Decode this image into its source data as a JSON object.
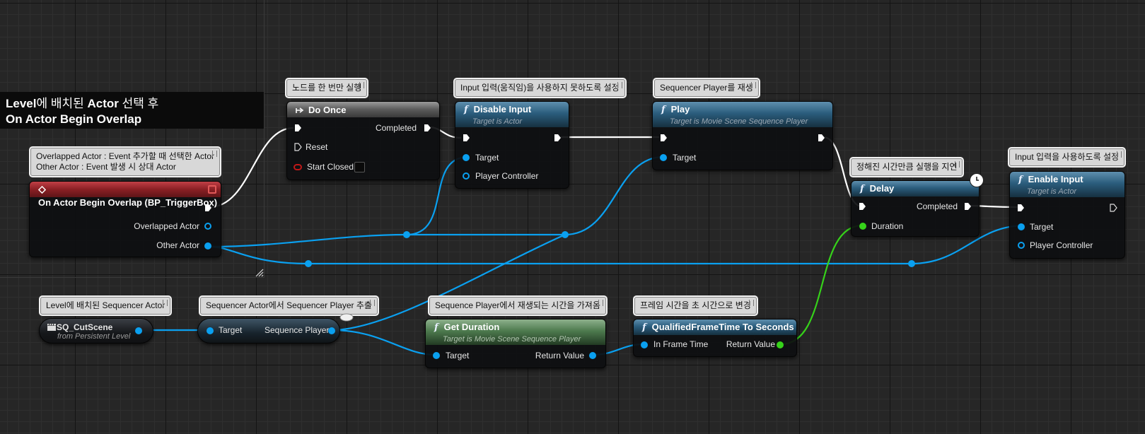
{
  "comment_region": {
    "line1_a": "Level",
    "line1_b": "에 배치된 ",
    "line1_c": "Actor",
    "line1_d": " 선택 후",
    "line2": "On Actor Begin Overlap"
  },
  "bubbles": {
    "overlap": [
      "Overlapped Actor : Event 추가할 때 선택한 Actor",
      "Other Actor : Event 발생 시 상대 Actor"
    ],
    "do_once": "노드를 한 번만 실행",
    "disable_input": "Input 입력(움직임)을 사용하지 못하도록 설정",
    "play": "Sequencer Player를 재생",
    "delay": "정해진 시간만큼 실행을 지연",
    "enable_input": "Input 입력을 사용하도록 설정",
    "sq_actor": "Level에 배치된 Sequencer Actor",
    "get_player": "Sequencer Actor에서 Sequencer Player 추출",
    "get_duration": "Sequence Player에서 재생되는 시간을 가져옴",
    "to_seconds": "프레임 시간을 초 시간으로 변경"
  },
  "nodes": {
    "event": {
      "title": "On Actor Begin Overlap (BP_TriggerBox)",
      "pins": [
        "Overlapped Actor",
        "Other Actor"
      ]
    },
    "do_once": {
      "title": "Do Once",
      "pins": [
        "Completed",
        "Reset",
        "Start Closed"
      ]
    },
    "disable_input": {
      "title": "Disable Input",
      "subtitle": "Target is Actor",
      "pins": [
        "Target",
        "Player Controller"
      ]
    },
    "play": {
      "title": "Play",
      "subtitle": "Target is Movie Scene Sequence Player",
      "pins": [
        "Target"
      ]
    },
    "delay": {
      "title": "Delay",
      "pins": [
        "Completed",
        "Duration"
      ]
    },
    "enable_input": {
      "title": "Enable Input",
      "subtitle": "Target is Actor",
      "pins": [
        "Target",
        "Player Controller"
      ]
    },
    "sq_cutscene": {
      "title": "SQ_CutScene",
      "subtitle": "from Persistent Level"
    },
    "get_player": {
      "pins": [
        "Target",
        "Sequence Player"
      ]
    },
    "get_duration": {
      "title": "Get Duration",
      "subtitle": "Target is Movie Scene Sequence Player",
      "pins": [
        "Target",
        "Return Value"
      ]
    },
    "to_seconds": {
      "title": "QualifiedFrameTime To Seconds",
      "pins": [
        "In Frame Time",
        "Return Value"
      ]
    }
  },
  "icons": {
    "function": "f-icon",
    "event": "event-diamond-icon",
    "do_once": "do-once-arrow-icon",
    "actor": "clapperboard-icon",
    "latent": "clock-icon"
  },
  "colors": {
    "exec_wire": "#ffffff",
    "object_wire": "#0aa0f0",
    "float_wire": "#36d21a",
    "event_header": "#8a1f24",
    "function_header": "#2b5d7d",
    "pure_header": "#4d7a4e"
  }
}
